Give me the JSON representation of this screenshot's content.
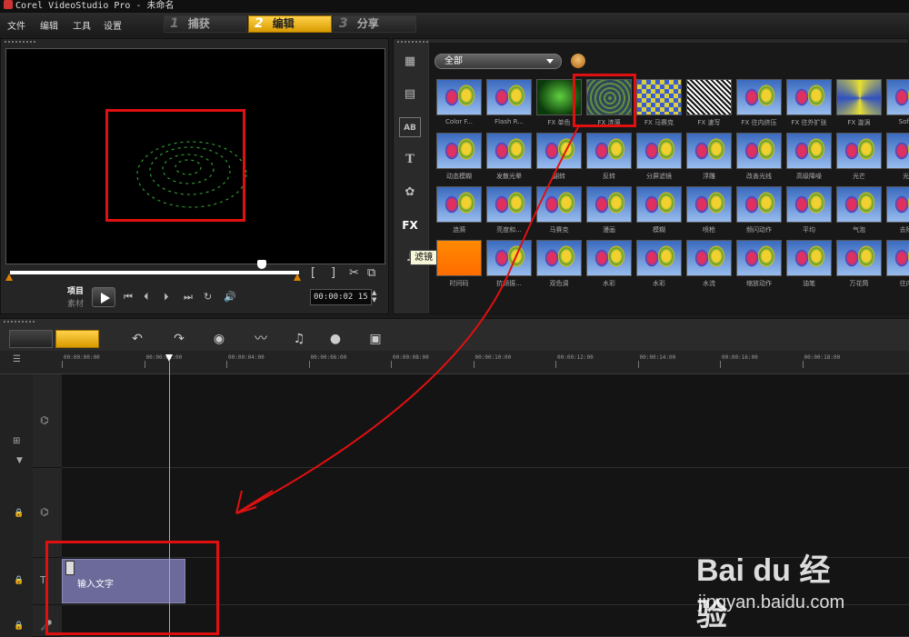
{
  "window": {
    "title": "Corel VideoStudio Pro - 未命名"
  },
  "menu": [
    "文件",
    "编辑",
    "工具",
    "设置"
  ],
  "steps": [
    {
      "num": "1",
      "label": "捕获",
      "active": false
    },
    {
      "num": "2",
      "label": "编辑",
      "active": true
    },
    {
      "num": "3",
      "label": "分享",
      "active": false
    }
  ],
  "player": {
    "mode_project": "项目",
    "mode_clip": "素材",
    "timecode": "00:00:02",
    "timecode_frame": "15",
    "scrub_position": 0.87
  },
  "library": {
    "category": "全部",
    "tooltip": "滤镜",
    "tabs": [
      "media-icon",
      "transition-icon",
      "title-icon",
      "text-icon",
      "graphic-icon",
      "fx-icon",
      "audio-icon"
    ],
    "filters": [
      "Color F...",
      "Flash R...",
      "FX 单色",
      "FX 涟漪",
      "FX 马赛克",
      "FX 速写",
      "FX 往内挤压",
      "FX 往外扩张",
      "FX 漩涡",
      "Soft ...",
      "动态模糊",
      "发散光晕",
      "翻转",
      "反转",
      "分屏滤镜",
      "浮雕",
      "改善光线",
      "高级降噪",
      "光芒",
      "光...",
      "涟漪",
      "亮度和...",
      "马赛克",
      "漫画",
      "模糊",
      "喷枪",
      "频闪动作",
      "平均",
      "气泡",
      "去除...",
      "时间码",
      "抗频振...",
      "双色调",
      "水彩",
      "水彩",
      "水流",
      "缩放动作",
      "油笔",
      "万花筒",
      "往内..."
    ]
  },
  "timeline": {
    "ruler_ticks": [
      "00:00:00:00",
      "00:00:02:00",
      "00:00:04:00",
      "00:00:06:00",
      "00:00:08:00",
      "00:00:10:00",
      "00:00:12:00",
      "00:00:14:00",
      "00:00:16:00",
      "00:00:18:00"
    ],
    "title_clip_text": "输入文字"
  },
  "watermark": {
    "brand": "Bai du 经验",
    "url": "jingyan.baidu.com"
  }
}
